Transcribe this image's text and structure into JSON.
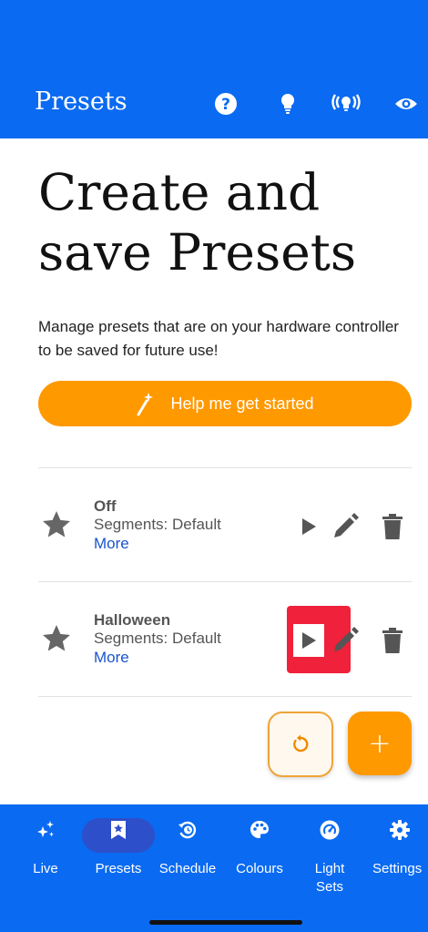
{
  "header": {
    "title": "Presets",
    "background": "#0a6af2",
    "icons": [
      "help-icon",
      "bulb-icon",
      "broadcast-icon",
      "eye-icon"
    ]
  },
  "main": {
    "title_line1": "Create and",
    "title_line2": "save Presets",
    "description": "Manage presets that are on your hardware controller to be saved for future use!",
    "cta_label": "Help me get started",
    "accent": "#ff9900"
  },
  "presets": [
    {
      "name": "Off",
      "segments": "Segments: Default",
      "more": "More"
    },
    {
      "name": "Halloween",
      "segments": "Segments: Default",
      "more": "More"
    }
  ],
  "fabs": {
    "add_label": "+"
  },
  "nav": {
    "items": [
      {
        "label": "Live",
        "icon": "sparkles-icon"
      },
      {
        "label": "Presets",
        "icon": "bookmark-star-icon",
        "active": true
      },
      {
        "label": "Schedule",
        "icon": "clock-history-icon"
      },
      {
        "label": "Colours",
        "icon": "palette-icon"
      },
      {
        "label": "Light",
        "label2": "Sets",
        "icon": "gauge-icon"
      },
      {
        "label": "Settings",
        "icon": "gear-icon"
      }
    ]
  }
}
